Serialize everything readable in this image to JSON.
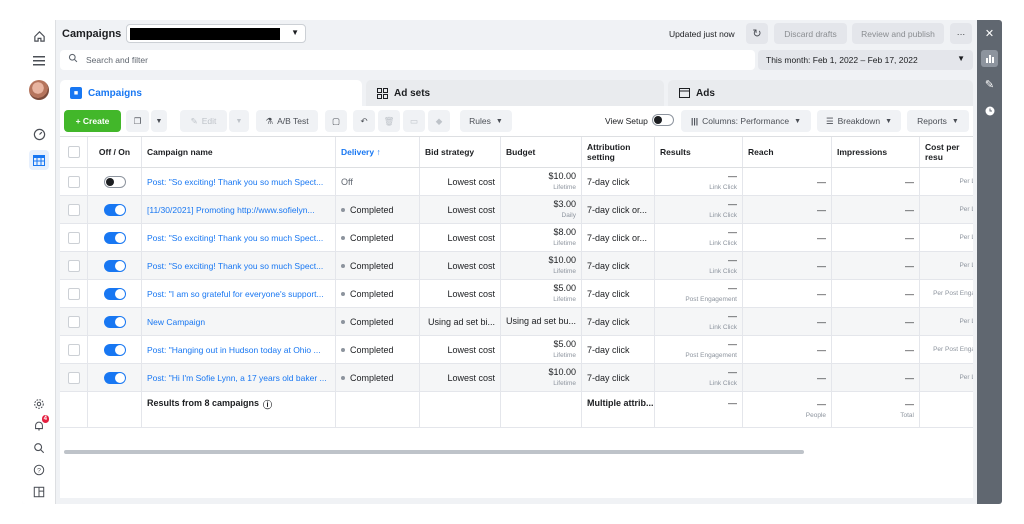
{
  "header": {
    "title": "Campaigns",
    "updated": "Updated just now",
    "discard_label": "Discard drafts",
    "review_label": "Review and publish",
    "more_label": "···"
  },
  "search": {
    "placeholder": "Search and filter"
  },
  "daterange": "This month: Feb 1, 2022 – Feb 17, 2022",
  "tabs": [
    {
      "label": "Campaigns"
    },
    {
      "label": "Ad sets"
    },
    {
      "label": "Ads"
    }
  ],
  "toolbar": {
    "create": "+ Create",
    "edit": "Edit",
    "abtest": "A/B Test",
    "rules": "Rules",
    "view_setup": "View Setup",
    "columns": "Columns: Performance",
    "breakdown": "Breakdown",
    "reports": "Reports"
  },
  "columns": [
    "Off / On",
    "Campaign name",
    "Delivery ↑",
    "Bid strategy",
    "Budget",
    "Attribution setting",
    "Results",
    "Reach",
    "Impressions",
    "Cost per resu"
  ],
  "rows": [
    {
      "on": false,
      "name": "Post: \"So exciting! Thank you so much Spect...",
      "delivery": "Off",
      "delivery_dot": false,
      "bid": "Lowest cost",
      "budget": "$10.00",
      "budget_type": "Lifetime",
      "attribution": "7-day click",
      "results": "—",
      "results_sub": "Link Click",
      "reach": "—",
      "impressions": "—",
      "cost_sub": "Per L"
    },
    {
      "on": true,
      "name": "[11/30/2021] Promoting http://www.sofielyn...",
      "delivery": "Completed",
      "delivery_dot": true,
      "bid": "Lowest cost",
      "budget": "$3.00",
      "budget_type": "Daily",
      "attribution": "7-day click or...",
      "results": "—",
      "results_sub": "Link Click",
      "reach": "—",
      "impressions": "—",
      "cost_sub": "Per L"
    },
    {
      "on": true,
      "name": "Post: \"So exciting! Thank you so much Spect...",
      "delivery": "Completed",
      "delivery_dot": true,
      "bid": "Lowest cost",
      "budget": "$8.00",
      "budget_type": "Lifetime",
      "attribution": "7-day click or...",
      "results": "—",
      "results_sub": "Link Click",
      "reach": "—",
      "impressions": "—",
      "cost_sub": "Per L"
    },
    {
      "on": true,
      "name": "Post: \"So exciting! Thank you so much Spect...",
      "delivery": "Completed",
      "delivery_dot": true,
      "bid": "Lowest cost",
      "budget": "$10.00",
      "budget_type": "Lifetime",
      "attribution": "7-day click",
      "results": "—",
      "results_sub": "Link Click",
      "reach": "—",
      "impressions": "—",
      "cost_sub": "Per L"
    },
    {
      "on": true,
      "name": "Post: \"I am so grateful for everyone's support...",
      "delivery": "Completed",
      "delivery_dot": true,
      "bid": "Lowest cost",
      "budget": "$5.00",
      "budget_type": "Lifetime",
      "attribution": "7-day click",
      "results": "—",
      "results_sub": "Post Engagement",
      "reach": "—",
      "impressions": "—",
      "cost_sub": "Per Post Enga"
    },
    {
      "on": true,
      "name": "New Campaign",
      "delivery": "Completed",
      "delivery_dot": true,
      "bid": "Using ad set bi...",
      "budget": "Using ad set bu...",
      "budget_type": "",
      "attribution": "7-day click",
      "results": "—",
      "results_sub": "Link Click",
      "reach": "—",
      "impressions": "—",
      "cost_sub": "Per L"
    },
    {
      "on": true,
      "name": "Post: \"Hanging out in Hudson today at Ohio ...",
      "delivery": "Completed",
      "delivery_dot": true,
      "bid": "Lowest cost",
      "budget": "$5.00",
      "budget_type": "Lifetime",
      "attribution": "7-day click",
      "results": "—",
      "results_sub": "Post Engagement",
      "reach": "—",
      "impressions": "—",
      "cost_sub": "Per Post Enga"
    },
    {
      "on": true,
      "name": "Post: \"Hi I'm Sofie Lynn, a 17 years old baker ...",
      "delivery": "Completed",
      "delivery_dot": true,
      "bid": "Lowest cost",
      "budget": "$10.00",
      "budget_type": "Lifetime",
      "attribution": "7-day click",
      "results": "—",
      "results_sub": "Link Click",
      "reach": "—",
      "impressions": "—",
      "cost_sub": "Per L"
    }
  ],
  "totals": {
    "label": "Results from 8 campaigns",
    "attribution": "Multiple attrib...",
    "results": "—",
    "reach": "—",
    "reach_sub": "People",
    "impressions": "—",
    "impressions_sub": "Total"
  },
  "sidebar": {
    "notif_count": "4"
  }
}
